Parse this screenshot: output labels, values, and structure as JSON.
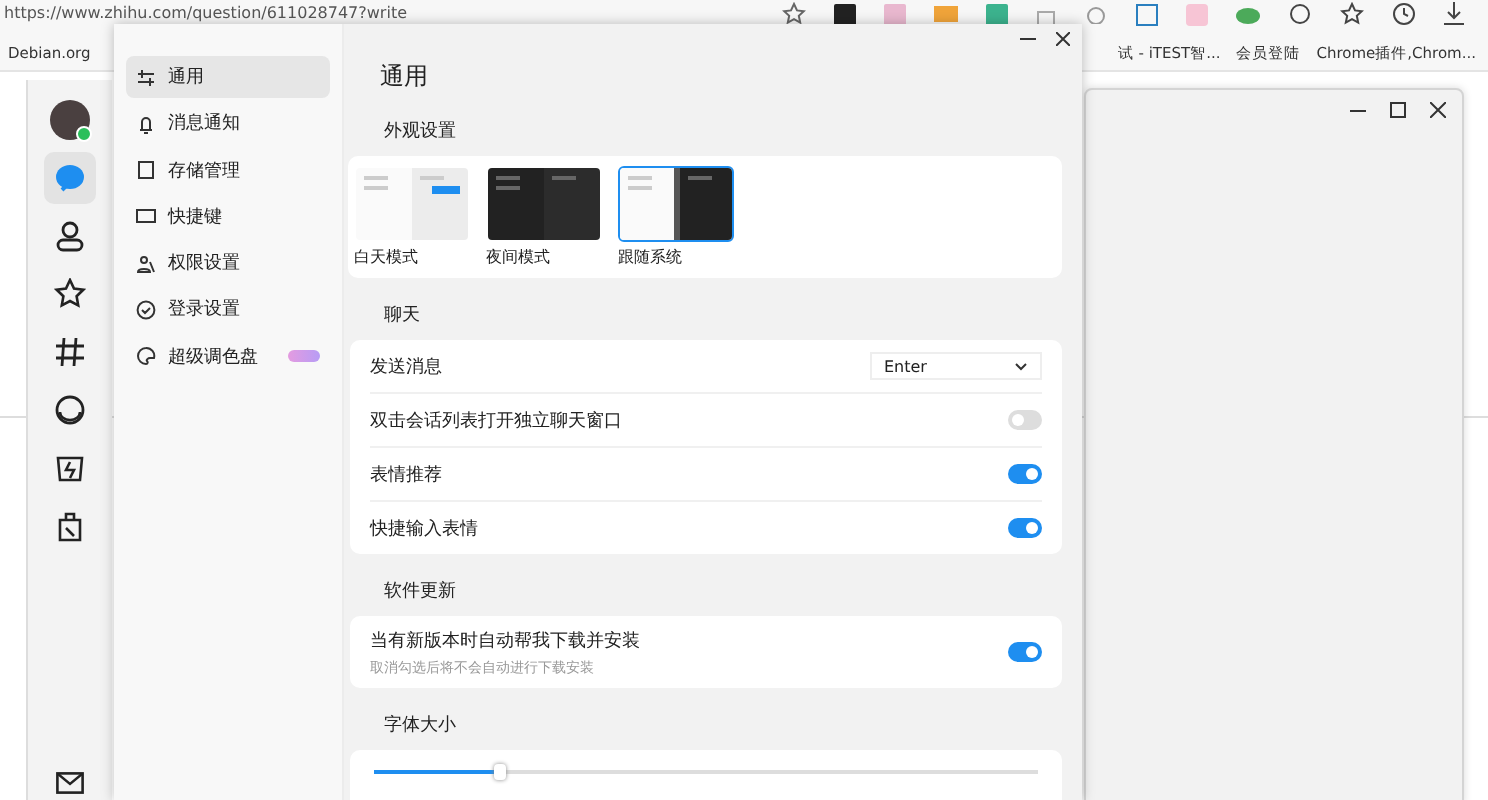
{
  "browser": {
    "url": "https://www.zhihu.com/question/611028747?write",
    "bookmarks": [
      {
        "label": "Debian.org"
      },
      {
        "label": "试 - iTEST智..."
      },
      {
        "label": "会员登陆"
      },
      {
        "label": "Chrome插件,Chrom..."
      }
    ]
  },
  "app": {
    "nav": [
      {
        "label": "通用",
        "selected": true
      },
      {
        "label": "消息通知",
        "selected": false
      },
      {
        "label": "存储管理",
        "selected": false
      },
      {
        "label": "快捷键",
        "selected": false
      },
      {
        "label": "权限设置",
        "selected": false
      },
      {
        "label": "登录设置",
        "selected": false
      },
      {
        "label": "超级调色盘",
        "selected": false,
        "badge": true
      }
    ],
    "rail": [
      {
        "selected": true
      },
      {
        "selected": false
      },
      {
        "selected": false
      },
      {
        "selected": false
      },
      {
        "selected": false
      },
      {
        "selected": false
      },
      {
        "selected": false
      }
    ],
    "title": "通用",
    "appearance": {
      "heading": "外观设置",
      "themes": [
        {
          "kind": "light",
          "label": "白天模式",
          "selected": false
        },
        {
          "kind": "dark",
          "label": "夜间模式",
          "selected": false
        },
        {
          "kind": "system",
          "label": "跟随系统",
          "selected": true
        }
      ]
    },
    "chat": {
      "heading": "聊天",
      "rows": [
        {
          "kind": "select",
          "label": "发送消息",
          "value": "Enter"
        },
        {
          "kind": "toggle",
          "label": "双击会话列表打开独立聊天窗口",
          "on": false
        },
        {
          "kind": "toggle",
          "label": "表情推荐",
          "on": true
        },
        {
          "kind": "toggle",
          "label": "快捷输入表情",
          "on": true
        }
      ]
    },
    "update": {
      "heading": "软件更新",
      "label": "当有新版本时自动帮我下载并安装",
      "hint": "取消勾选后将不会自动进行下载安装",
      "on": true
    },
    "font": {
      "heading": "字体大小",
      "level": 0.19
    }
  }
}
